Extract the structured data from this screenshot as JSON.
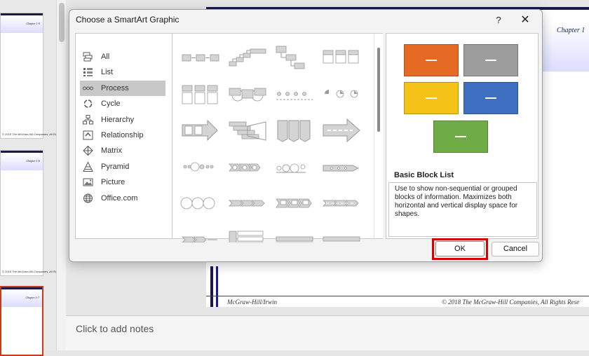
{
  "background": {
    "thumbnails": [
      {
        "chapter": "Chapter 1-5",
        "copyright": "© 2018 The McGraw-Hill Companies, All Rights Reserved",
        "selected": false
      },
      {
        "chapter": "Chapter 1-6",
        "copyright": "© 2018 The McGraw-Hill Companies, All Rights Reserved",
        "selected": false
      },
      {
        "chapter": "Chapter 1-7",
        "copyright": "",
        "selected": true
      }
    ],
    "slide": {
      "chapter": "Chapter 1",
      "footer_left": "McGraw-Hill/Irwin",
      "footer_right": "© 2018 The McGraw-Hill Companies, All Rights Rese"
    },
    "notes_placeholder": "Click to add notes"
  },
  "dialog": {
    "title": "Choose a SmartArt Graphic",
    "help_label": "?",
    "close_label": "✕",
    "categories": [
      {
        "label": "All",
        "icon": "all-icon",
        "selected": false
      },
      {
        "label": "List",
        "icon": "list-icon",
        "selected": false
      },
      {
        "label": "Process",
        "icon": "process-icon",
        "selected": true
      },
      {
        "label": "Cycle",
        "icon": "cycle-icon",
        "selected": false
      },
      {
        "label": "Hierarchy",
        "icon": "hierarchy-icon",
        "selected": false
      },
      {
        "label": "Relationship",
        "icon": "relationship-icon",
        "selected": false
      },
      {
        "label": "Matrix",
        "icon": "matrix-icon",
        "selected": false
      },
      {
        "label": "Pyramid",
        "icon": "pyramid-icon",
        "selected": false
      },
      {
        "label": "Picture",
        "icon": "picture-icon",
        "selected": false
      },
      {
        "label": "Office.com",
        "icon": "globe-icon",
        "selected": false
      }
    ],
    "gallery_items": [
      "basic-process-icon",
      "step-up-process-icon",
      "step-down-process-icon",
      "accent-process-icon",
      "alternating-flow-icon",
      "continuous-block-process-icon",
      "increasing-arrows-process-icon",
      "continuous-arrow-process-icon",
      "process-arrows-icon",
      "circle-accent-timeline-icon",
      "basic-chevron-process-icon",
      "upward-arrow-icon",
      "basic-timeline-icon",
      "circle-process-icon",
      "segmented-process-icon",
      "arrow-ribbon-icon",
      "circle-arrow-process-icon",
      "chevron-accent-process-icon",
      "chevron-list-icon",
      "pie-process-icon",
      "gear-process-icon",
      "vertical-process-icon",
      "sub-step-process-icon",
      "phased-process-icon"
    ],
    "preview": {
      "blocks": [
        {
          "color": "#e56b25"
        },
        {
          "color": "#9d9d9d"
        },
        {
          "color": "#f5c217"
        },
        {
          "color": "#3e6fc1"
        },
        {
          "color": "#6fac46"
        }
      ],
      "block_text": "—",
      "name": "Basic Block List",
      "description": "Use to show non-sequential or grouped blocks of information. Maximizes both horizontal and vertical display space for shapes."
    },
    "ok_label": "OK",
    "cancel_label": "Cancel",
    "highlight_color": "#d50000"
  }
}
